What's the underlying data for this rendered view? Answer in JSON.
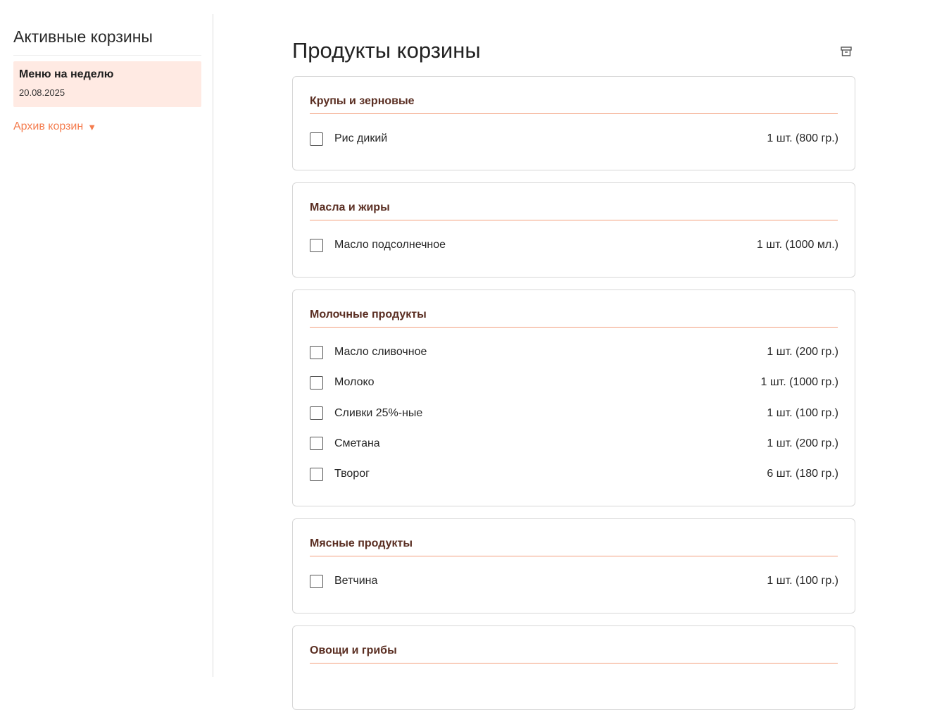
{
  "sidebar": {
    "title": "Активные корзины",
    "carts": [
      {
        "name": "Меню на неделю",
        "date": "20.08.2025"
      }
    ],
    "archive_label": "Архив корзин",
    "archive_arrow": "▼"
  },
  "main": {
    "title": "Продукты корзины",
    "archive_icon": "archive-box-icon",
    "accent_color": "#f47c4e",
    "categories": [
      {
        "title": "Крупы и зерновые",
        "items": [
          {
            "name": "Рис дикий",
            "qty": "1 шт. (800 гр.)"
          }
        ]
      },
      {
        "title": "Масла и жиры",
        "items": [
          {
            "name": "Масло подсолнечное",
            "qty": "1 шт. (1000 мл.)"
          }
        ]
      },
      {
        "title": "Молочные продукты",
        "items": [
          {
            "name": "Масло сливочное",
            "qty": "1 шт. (200 гр.)"
          },
          {
            "name": "Молоко",
            "qty": "1 шт. (1000 гр.)"
          },
          {
            "name": "Сливки 25%-ные",
            "qty": "1 шт. (100 гр.)"
          },
          {
            "name": "Сметана",
            "qty": "1 шт. (200 гр.)"
          },
          {
            "name": "Творог",
            "qty": "6 шт. (180 гр.)"
          }
        ]
      },
      {
        "title": "Мясные продукты",
        "items": [
          {
            "name": "Ветчина",
            "qty": "1 шт. (100 гр.)"
          }
        ]
      },
      {
        "title": "Овощи и грибы",
        "items": []
      }
    ]
  }
}
